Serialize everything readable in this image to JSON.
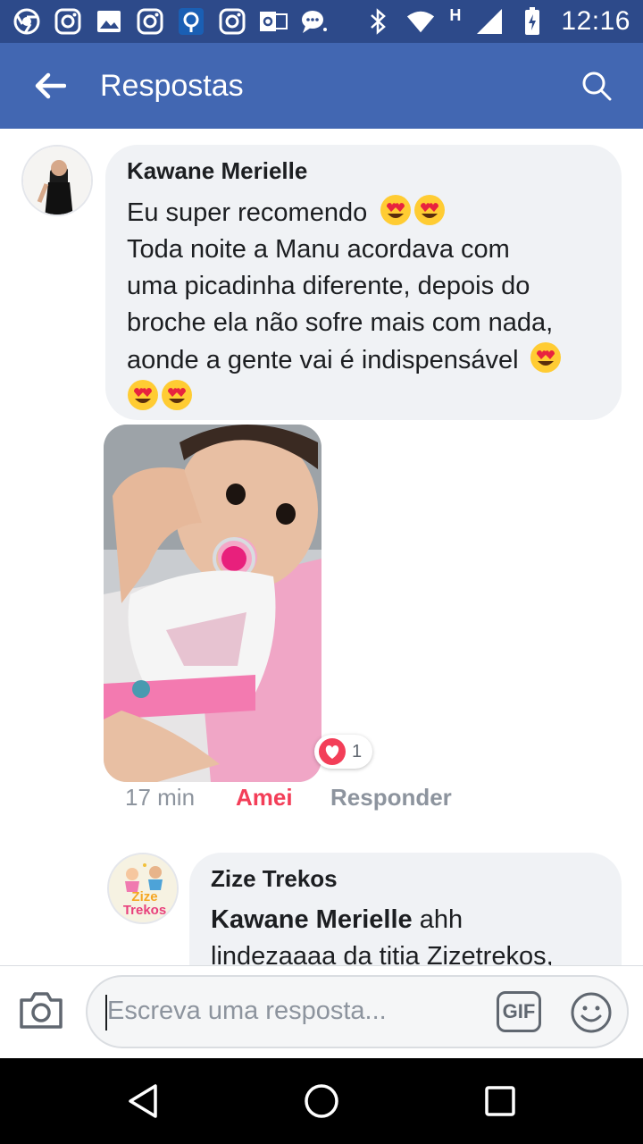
{
  "status_bar": {
    "time": "12:16",
    "network_letter": "H",
    "icons": [
      "chrome-icon",
      "instagram-icon",
      "gallery-icon",
      "instagram-icon",
      "notification-icon",
      "instagram-icon",
      "outlook-icon",
      "chat-icon",
      "bluetooth-icon",
      "wifi-icon",
      "signal-icon",
      "battery-icon"
    ]
  },
  "header": {
    "title": "Respostas",
    "accent": "#4267b2"
  },
  "comment": {
    "author": "Kawane Merielle",
    "lines": [
      "Eu super recomendo",
      "Toda noite a Manu acordava com",
      "uma picadinha diferente, depois do",
      "broche ela não sofre mais com nada,",
      "aonde a gente vai é indispensável"
    ],
    "reaction_count": "1",
    "time": "17 min",
    "reaction_label": "Amei",
    "reply_label": "Responder"
  },
  "reply": {
    "author": "Zize Trekos",
    "mention": "Kawane Merielle",
    "text_after_mention": " ahh",
    "line2": "lindezaaaa da titia Zizetrekos,",
    "avatar_text_1": "Zize",
    "avatar_text_2": "Trekos"
  },
  "reply_bar": {
    "placeholder": "Escreva uma resposta...",
    "gif_label": "GIF"
  },
  "colors": {
    "love": "#f33e58",
    "bubble": "#f0f2f5",
    "muted": "#8d949e"
  }
}
